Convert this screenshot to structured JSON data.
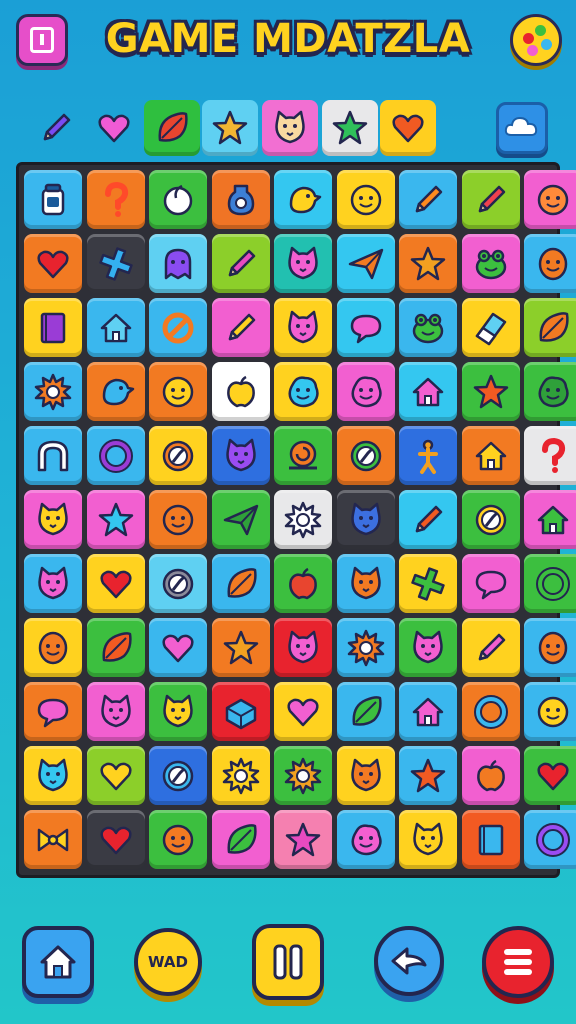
{
  "header": {
    "title": "GAME MDATZLA"
  },
  "item_bar": {
    "items": [
      {
        "icon": "pencil-icon",
        "bg": "transparent",
        "color": "#7a4cf2"
      },
      {
        "icon": "heart-icon",
        "bg": "transparent",
        "color": "#f05bd5"
      },
      {
        "icon": "leaf-icon",
        "bg": "#2fbf3f",
        "color": "#e8452f"
      },
      {
        "icon": "star-icon",
        "bg": "#5fd0f2",
        "color": "#f2b632"
      },
      {
        "icon": "cat-face-icon",
        "bg": "#f26fd2",
        "color": "#f8d9a0"
      },
      {
        "icon": "star-icon",
        "bg": "#e8e8ea",
        "color": "#2fbf5a"
      },
      {
        "icon": "heart-icon",
        "bg": "#ffcf1f",
        "color": "#f05a22"
      }
    ]
  },
  "board": {
    "rows": [
      [
        {
          "bg": "#3ab7ee",
          "icon": "jar-icon",
          "fg": "#1a5a9a"
        },
        {
          "bg": "#f27a22",
          "icon": "question-icon",
          "fg": "#ff4a2a"
        },
        {
          "bg": "#3cbf3f",
          "icon": "moon-icon",
          "fg": "#ffffff"
        },
        {
          "bg": "#f07425",
          "icon": "bottle-icon",
          "fg": "#3c7fd6"
        },
        {
          "bg": "#34c7f0",
          "icon": "bird-icon",
          "fg": "#ffd21f"
        },
        {
          "bg": "#ffd21f",
          "icon": "smile-face-icon",
          "fg": "#ffd21f"
        },
        {
          "bg": "#3ab7ee",
          "icon": "pencil-icon",
          "fg": "#ff8a1f"
        },
        {
          "bg": "#8ccf2a",
          "icon": "pencil-icon",
          "fg": "#f0424e"
        },
        {
          "bg": "#f25fd0",
          "icon": "smile-face-icon",
          "fg": "#ff8a3a"
        }
      ],
      [
        {
          "bg": "#f27a22",
          "icon": "heart-icon",
          "fg": "#e8232e"
        },
        {
          "bg": "#3a3b44",
          "icon": "cross-icon",
          "fg": "#34b0f0"
        },
        {
          "bg": "#5fd0f2",
          "icon": "ghost-icon",
          "fg": "#8a4cf2"
        },
        {
          "bg": "#8ccf2a",
          "icon": "pencil-icon",
          "fg": "#e84ac0"
        },
        {
          "bg": "#22c0b0",
          "icon": "cat-face-icon",
          "fg": "#f25fd0"
        },
        {
          "bg": "#34c7f0",
          "icon": "paper-plane-icon",
          "fg": "#f27a22"
        },
        {
          "bg": "#f27a22",
          "icon": "star-icon",
          "fg": "#f2a020"
        },
        {
          "bg": "#f25fd0",
          "icon": "frog-icon",
          "fg": "#3cbf3f"
        },
        {
          "bg": "#3ab7ee",
          "icon": "face-icon",
          "fg": "#f27a22"
        }
      ],
      [
        {
          "bg": "#ffd21f",
          "icon": "book-icon",
          "fg": "#9a3cd6"
        },
        {
          "bg": "#3ab7ee",
          "icon": "house-icon",
          "fg": "#5fd0f2"
        },
        {
          "bg": "#3ab7ee",
          "icon": "no-sign-icon",
          "fg": "#f27a22"
        },
        {
          "bg": "#f25fd0",
          "icon": "pencil-icon",
          "fg": "#ffd21f"
        },
        {
          "bg": "#ffd21f",
          "icon": "cat-face-icon",
          "fg": "#f25fd0"
        },
        {
          "bg": "#34c7f0",
          "icon": "speech-bubble-icon",
          "fg": "#f25fd0"
        },
        {
          "bg": "#3ab7ee",
          "icon": "frog-icon",
          "fg": "#3cbf3f"
        },
        {
          "bg": "#ffd21f",
          "icon": "eraser-icon",
          "fg": "#5fd0f2"
        },
        {
          "bg": "#8ccf2a",
          "icon": "leaf-icon",
          "fg": "#f27a22"
        }
      ],
      [
        {
          "bg": "#3ab7ee",
          "icon": "sun-icon",
          "fg": "#f27a22"
        },
        {
          "bg": "#f27a22",
          "icon": "bird-icon",
          "fg": "#3ab7ee"
        },
        {
          "bg": "#f27a22",
          "icon": "smile-face-icon",
          "fg": "#ffd21f"
        },
        {
          "bg": "#ffffff",
          "icon": "apple-icon",
          "fg": "#ffd21f"
        },
        {
          "bg": "#ffd21f",
          "icon": "blob-icon",
          "fg": "#34c7f0"
        },
        {
          "bg": "#f25fd0",
          "icon": "blob-icon",
          "fg": "#f25fd0"
        },
        {
          "bg": "#34c7f0",
          "icon": "house-icon",
          "fg": "#f25fd0"
        },
        {
          "bg": "#3cbf3f",
          "icon": "star-icon",
          "fg": "#f25a22"
        },
        {
          "bg": "#3cbf3f",
          "icon": "blob-icon",
          "fg": "#2fa03a"
        }
      ],
      [
        {
          "bg": "#3ab7ee",
          "icon": "arch-icon",
          "fg": "#ffffff"
        },
        {
          "bg": "#3ab7ee",
          "icon": "ring-icon",
          "fg": "#9a3cd6"
        },
        {
          "bg": "#ffd21f",
          "icon": "compass-icon",
          "fg": "#f27a22"
        },
        {
          "bg": "#2e6fe0",
          "icon": "cat-face-icon",
          "fg": "#9a4cf2"
        },
        {
          "bg": "#3cbf3f",
          "icon": "snail-icon",
          "fg": "#f27a22"
        },
        {
          "bg": "#f27a22",
          "icon": "compass-icon",
          "fg": "#3cbf3f"
        },
        {
          "bg": "#2e6fe0",
          "icon": "figure-icon",
          "fg": "#f2a020"
        },
        {
          "bg": "#f27a22",
          "icon": "house-icon",
          "fg": "#ffd21f"
        },
        {
          "bg": "#e8e8ea",
          "icon": "question-icon",
          "fg": "#e8232e"
        }
      ],
      [
        {
          "bg": "#f25fd0",
          "icon": "cat-face-icon",
          "fg": "#ffd21f"
        },
        {
          "bg": "#f25fd0",
          "icon": "star-icon",
          "fg": "#34c7f0"
        },
        {
          "bg": "#f27a22",
          "icon": "smile-face-icon",
          "fg": "#f27a22"
        },
        {
          "bg": "#3cbf3f",
          "icon": "paper-plane-icon",
          "fg": "#2fa03a"
        },
        {
          "bg": "#e8e8ea",
          "icon": "sun-icon",
          "fg": "#ffffff"
        },
        {
          "bg": "#3a3b44",
          "icon": "cat-face-icon",
          "fg": "#3c6fe0"
        },
        {
          "bg": "#34c7f0",
          "icon": "pencil-icon",
          "fg": "#f25a22"
        },
        {
          "bg": "#3cbf3f",
          "icon": "compass-icon",
          "fg": "#ffd21f"
        },
        {
          "bg": "#f25fd0",
          "icon": "house-icon",
          "fg": "#3cbf3f"
        }
      ],
      [
        {
          "bg": "#3ab7ee",
          "icon": "cat-face-icon",
          "fg": "#f25fd0"
        },
        {
          "bg": "#ffd21f",
          "icon": "heart-icon",
          "fg": "#e8232e"
        },
        {
          "bg": "#5fd0f2",
          "icon": "compass-icon",
          "fg": "#8a8a9a"
        },
        {
          "bg": "#3ab7ee",
          "icon": "leaf-icon",
          "fg": "#f27a22"
        },
        {
          "bg": "#3cbf3f",
          "icon": "apple-icon",
          "fg": "#e8452f"
        },
        {
          "bg": "#3ab7ee",
          "icon": "cat-face-icon",
          "fg": "#f27a22"
        },
        {
          "bg": "#ffd21f",
          "icon": "cross-icon",
          "fg": "#3cbf3f"
        },
        {
          "bg": "#f25fd0",
          "icon": "speech-bubble-icon",
          "fg": "#f25fd0"
        },
        {
          "bg": "#3cbf3f",
          "icon": "ring-icon",
          "fg": "#3cbf3f"
        }
      ],
      [
        {
          "bg": "#ffd21f",
          "icon": "face-icon",
          "fg": "#f27a22"
        },
        {
          "bg": "#3cbf3f",
          "icon": "leaf-icon",
          "fg": "#f25a22"
        },
        {
          "bg": "#3ab7ee",
          "icon": "heart-icon",
          "fg": "#f25fd0"
        },
        {
          "bg": "#f27a22",
          "icon": "star-icon",
          "fg": "#f2a020"
        },
        {
          "bg": "#e8232e",
          "icon": "cat-face-icon",
          "fg": "#f25fd0"
        },
        {
          "bg": "#3ab7ee",
          "icon": "sun-icon",
          "fg": "#f27a22"
        },
        {
          "bg": "#3cbf3f",
          "icon": "cat-face-icon",
          "fg": "#f25fd0"
        },
        {
          "bg": "#ffd21f",
          "icon": "pencil-icon",
          "fg": "#f25fd0"
        },
        {
          "bg": "#3ab7ee",
          "icon": "face-icon",
          "fg": "#f27a22"
        }
      ],
      [
        {
          "bg": "#f27a22",
          "icon": "speech-bubble-icon",
          "fg": "#f25fd0"
        },
        {
          "bg": "#f25fd0",
          "icon": "cat-face-icon",
          "fg": "#f25fd0"
        },
        {
          "bg": "#3cbf3f",
          "icon": "cat-face-icon",
          "fg": "#ffd21f"
        },
        {
          "bg": "#e8232e",
          "icon": "box-icon",
          "fg": "#3ab7ee"
        },
        {
          "bg": "#ffd21f",
          "icon": "heart-icon",
          "fg": "#f25fd0"
        },
        {
          "bg": "#3ab7ee",
          "icon": "leaf-icon",
          "fg": "#3cbf3f"
        },
        {
          "bg": "#3ab7ee",
          "icon": "house-icon",
          "fg": "#f25fd0"
        },
        {
          "bg": "#f27a22",
          "icon": "ring-icon",
          "fg": "#3ab7ee"
        },
        {
          "bg": "#3ab7ee",
          "icon": "smile-face-icon",
          "fg": "#ffd21f"
        }
      ],
      [
        {
          "bg": "#ffd21f",
          "icon": "cat-face-icon",
          "fg": "#34c7f0"
        },
        {
          "bg": "#8ccf2a",
          "icon": "heart-icon",
          "fg": "#ffd21f"
        },
        {
          "bg": "#2e6fe0",
          "icon": "compass-icon",
          "fg": "#3ab7ee"
        },
        {
          "bg": "#ffd21f",
          "icon": "sun-icon",
          "fg": "#ffd21f"
        },
        {
          "bg": "#3cbf3f",
          "icon": "sun-icon",
          "fg": "#f2a020"
        },
        {
          "bg": "#ffd21f",
          "icon": "cat-face-icon",
          "fg": "#f27a22"
        },
        {
          "bg": "#3ab7ee",
          "icon": "star-icon",
          "fg": "#f25a22"
        },
        {
          "bg": "#f25fd0",
          "icon": "apple-icon",
          "fg": "#f27a22"
        },
        {
          "bg": "#3cbf3f",
          "icon": "heart-icon",
          "fg": "#e8232e"
        }
      ],
      [
        {
          "bg": "#f27a22",
          "icon": "bow-icon",
          "fg": "#ffd21f"
        },
        {
          "bg": "#3a3b44",
          "icon": "heart-icon",
          "fg": "#e8232e"
        },
        {
          "bg": "#3cbf3f",
          "icon": "smile-face-icon",
          "fg": "#f27a22"
        },
        {
          "bg": "#f25fd0",
          "icon": "leaf-icon",
          "fg": "#3cbf3f"
        },
        {
          "bg": "#f580b0",
          "icon": "star-icon",
          "fg": "#e84ac0"
        },
        {
          "bg": "#3ab7ee",
          "icon": "blob-icon",
          "fg": "#f25fd0"
        },
        {
          "bg": "#ffd21f",
          "icon": "cat-face-icon",
          "fg": "#ffd21f"
        },
        {
          "bg": "#f25a22",
          "icon": "book-icon",
          "fg": "#3ab7ee"
        },
        {
          "bg": "#3ab7ee",
          "icon": "ring-icon",
          "fg": "#9a4cf2"
        }
      ]
    ]
  },
  "nav": {
    "home_icon": "home-icon",
    "middle_label": "WAD",
    "pause_icon": "pause-icon",
    "back_icon": "back-arrow-icon",
    "list_icon": "list-icon"
  }
}
